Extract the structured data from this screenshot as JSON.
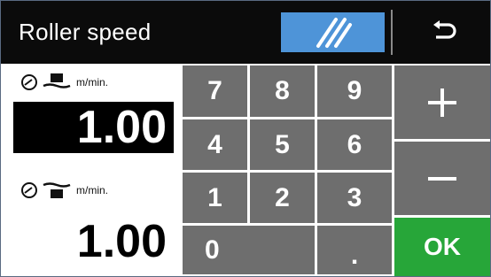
{
  "header": {
    "title": "Roller speed",
    "mode_button_icon": "diagonal-slash-icon",
    "back_button_icon": "back-arrow-icon"
  },
  "readouts": [
    {
      "unit": "m/min.",
      "value": "1.00",
      "active": true,
      "icons": [
        "timer-icon",
        "roller-top-icon"
      ]
    },
    {
      "unit": "m/min.",
      "value": "1.00",
      "active": false,
      "icons": [
        "timer-icon",
        "roller-bottom-icon"
      ]
    }
  ],
  "keypad": {
    "keys": [
      "7",
      "8",
      "9",
      "4",
      "5",
      "6",
      "1",
      "2",
      "3",
      "0",
      "."
    ]
  },
  "side_buttons": {
    "plus": "+",
    "minus": "−",
    "ok": "OK"
  },
  "colors": {
    "header_bg": "#0b0b0b",
    "mode_button": "#4e94d8",
    "key_gray": "#6e6e6e",
    "ok_green": "#27a639",
    "active_value_bg": "#000000"
  }
}
